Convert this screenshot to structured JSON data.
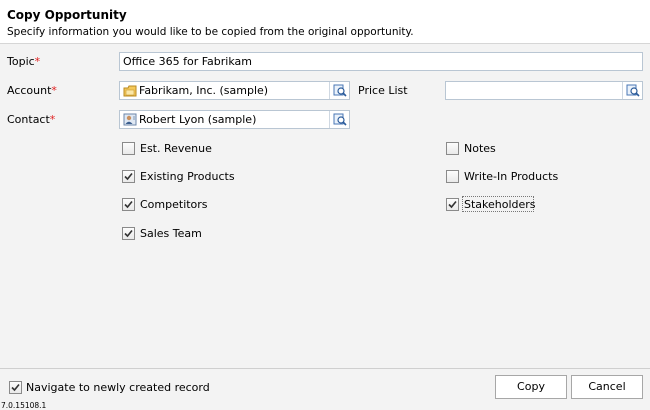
{
  "header": {
    "title": "Copy Opportunity",
    "subtitle": "Specify information you would like to be copied from the original opportunity."
  },
  "fields": {
    "topic": {
      "label": "Topic",
      "required_mark": "*",
      "value": "Office 365 for Fabrikam"
    },
    "account": {
      "label": "Account",
      "required_mark": "*",
      "value": "Fabrikam, Inc. (sample)",
      "icon": "account-icon"
    },
    "contact": {
      "label": "Contact",
      "required_mark": "*",
      "value": "Robert Lyon (sample)",
      "icon": "contact-icon"
    },
    "price_list": {
      "label": "Price List",
      "value": ""
    }
  },
  "options": {
    "est_revenue": {
      "label": "Est. Revenue",
      "checked": false
    },
    "existing_products": {
      "label": "Existing Products",
      "checked": true
    },
    "competitors": {
      "label": "Competitors",
      "checked": true
    },
    "sales_team": {
      "label": "Sales Team",
      "checked": true
    },
    "notes": {
      "label": "Notes",
      "checked": false
    },
    "write_in_products": {
      "label": "Write-In Products",
      "checked": false
    },
    "stakeholders": {
      "label": "Stakeholders",
      "checked": true
    }
  },
  "footer": {
    "navigate_label": "Navigate to newly created record",
    "navigate_checked": true,
    "copy_label": "Copy",
    "cancel_label": "Cancel",
    "version": "7.0.15108.1"
  },
  "colors": {
    "required": "#e02020",
    "field_border": "#b9c6d3",
    "background": "#f3f3f3"
  }
}
